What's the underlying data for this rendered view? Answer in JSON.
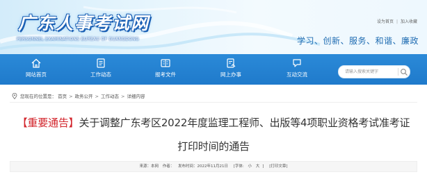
{
  "header": {
    "logo_cn": "广东人事考试网",
    "logo_en": "PERSONNEL EXAMINATIONS BUREAU OF GUANGDONG",
    "top_links": [
      "设为首页",
      "加入收藏"
    ],
    "slogan": "学习、创新、服务、和谐、廉政"
  },
  "nav": {
    "items": [
      {
        "label": "网站首页",
        "icon": "home-icon"
      },
      {
        "label": "工作动态",
        "icon": "news-icon"
      },
      {
        "label": "报考文件",
        "icon": "document-icon"
      },
      {
        "label": "网上办事",
        "icon": "online-service-icon"
      },
      {
        "label": "互动交流",
        "icon": "chat-icon"
      }
    ],
    "search_placeholder": "请输入搜索关键字"
  },
  "breadcrumb": {
    "prefix": "您现在的位置是：",
    "items": [
      "首页",
      "政务公开",
      "工作动态",
      "详细内容"
    ]
  },
  "article": {
    "tag": "【重要通告】",
    "title_line1": "关于调整广东考区2022年度监理工程师、出版等4项职业资格考试准考证",
    "title_line2": "打印时间的通告",
    "meta": {
      "source_label": "来源：本网",
      "author_label": "作者：",
      "date_label": "发布时间：2022年11月21日",
      "font_label": "[字体:",
      "font_small": "小",
      "font_large": "大",
      "font_close": "]",
      "print_label": "[打印文章]"
    }
  },
  "colors": {
    "nav_bg": "#1f7acb",
    "slogan": "#1f6cb2",
    "tag_red": "#d2232a"
  }
}
